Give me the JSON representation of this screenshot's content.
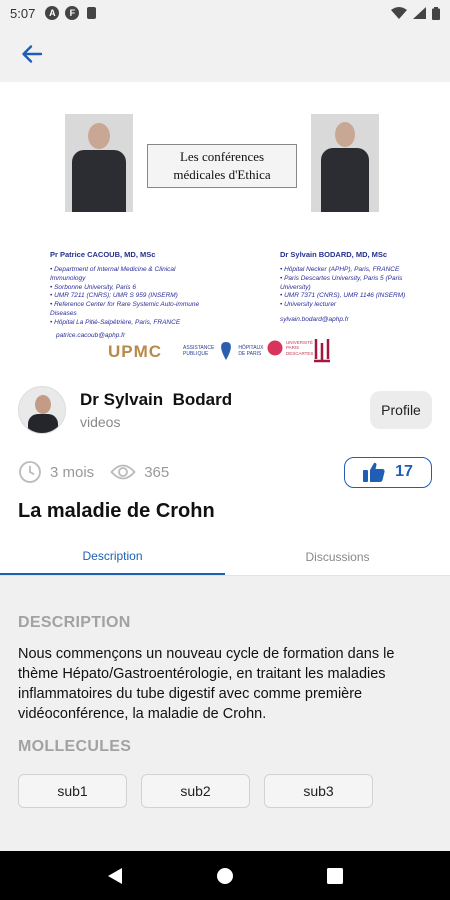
{
  "status_bar": {
    "time": "5:07",
    "icons": [
      "a-icon",
      "f-icon",
      "sd-card-icon"
    ],
    "right_icons": [
      "wifi-icon",
      "signal-icon",
      "battery-icon"
    ]
  },
  "app_bar": {
    "back_icon": "arrow-left-icon"
  },
  "thumbnail": {
    "title_line1": "Les conférences",
    "title_line2": "médicales d'Ethica",
    "speaker_left": {
      "name": "Pr Patrice CACOUB, MD, MSc",
      "affiliations": [
        "• Department of Internal Medicine & Clinical",
        "  Immunology",
        "• Sorbonne University, Paris 6",
        "• UMR 7211 (CNRS); UMR S 959 (INSERM)",
        "• Reference Center for Rare Systemic Auto-immune",
        "  Diseases",
        "• Hôpital La Pitié-Salpêtrière, Paris, FRANCE"
      ],
      "email": "patrice.cacoub@aphp.fr"
    },
    "speaker_right": {
      "name": "Dr Sylvain BODARD, MD, MSc",
      "affiliations": [
        "• Hôpital Necker (APHP), Paris, FRANCE",
        "• Paris Descartes University, Paris 5 (Paris",
        "  University)",
        "• UMR 7371 (CNRS), UMR 1146 (INSERM)",
        "• University lecturer"
      ],
      "email": "sylvain.bodard@aphp.fr"
    },
    "logos": {
      "upmc": "UPMC",
      "aphp_line1": "ASSISTANCE",
      "aphp_line2": "PUBLIQUE",
      "aphp_line3": "HÔPITAUX",
      "aphp_line4": "DE PARIS",
      "univ_line1": "UNIVERSITÉ",
      "univ_line2": "PARIS",
      "univ_line3": "DESCARTES"
    }
  },
  "author": {
    "name": "Dr Sylvain  Bodard",
    "subtitle": "videos",
    "profile_label": "Profile"
  },
  "stats": {
    "age": "3 mois",
    "views": "365",
    "likes": "17"
  },
  "video_title": "La maladie de Crohn",
  "tabs": [
    {
      "label": "Description",
      "active": true
    },
    {
      "label": "Discussions",
      "active": false
    }
  ],
  "description": {
    "heading": "DESCRIPTION",
    "text": "Nous commençons un nouveau cycle de formation dans le thème Hépato/Gastroentérologie, en traitant les maladies inflammatoires du tube digestif avec comme première vidéoconférence, la maladie de Crohn."
  },
  "molecules": {
    "heading": "MOLLECULES",
    "items": [
      "sub1",
      "sub2",
      "sub3"
    ]
  },
  "colors": {
    "accent": "#1e5fb5",
    "muted": "#a2a2a2",
    "content_bg": "#f0f0f0"
  }
}
